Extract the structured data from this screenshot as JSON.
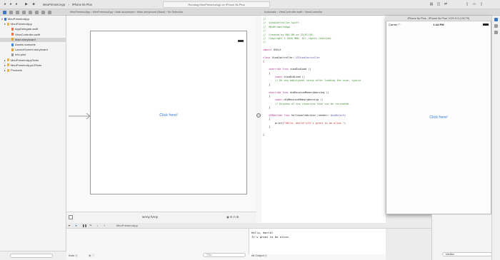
{
  "toolbar": {
    "scheme": "MeuPrimeiroApp",
    "destination": "iPhone 8s Plus",
    "status": "Running MeuPrimeiroApp on iPhone 8s Plus"
  },
  "jump_bar_left": [
    "MeuPrimeiroApp",
    "MeuPrimeiroApp",
    "Main.storyboard",
    "Main.storyboard (Base)",
    "No Selection"
  ],
  "jump_bar_right": [
    "Automatic",
    "ViewController.swift",
    "ViewController"
  ],
  "navigator": {
    "items": [
      {
        "label": "MeuPrimeiroApp",
        "icon": "project-icon",
        "color": "#3a78c2",
        "selected": false
      },
      {
        "label": "MeuPrimeiroApp",
        "icon": "folder-icon",
        "color": "#e5b54a",
        "selected": false
      },
      {
        "label": "AppDelegate.swift",
        "icon": "swift-file-icon",
        "color": "#e8754a",
        "selected": false
      },
      {
        "label": "ViewController.swift",
        "icon": "swift-file-icon",
        "color": "#e8754a",
        "selected": false
      },
      {
        "label": "Main.storyboard",
        "icon": "storyboard-file-icon",
        "color": "#d8a43a",
        "selected": true
      },
      {
        "label": "Assets.xcassets",
        "icon": "assets-icon",
        "color": "#3a8ad8",
        "selected": false
      },
      {
        "label": "LaunchScreen.storyboard",
        "icon": "storyboard-file-icon",
        "color": "#d8a43a",
        "selected": false
      },
      {
        "label": "Info.plist",
        "icon": "plist-icon",
        "color": "#9a9a9a",
        "selected": false
      },
      {
        "label": "MeuPrimeiroAppTests",
        "icon": "folder-icon",
        "color": "#e5b54a",
        "selected": false
      },
      {
        "label": "MeuPrimeiroAppUITests",
        "icon": "folder-icon",
        "color": "#e5b54a",
        "selected": false
      },
      {
        "label": "Products",
        "icon": "folder-icon",
        "color": "#e5b54a",
        "selected": false
      }
    ]
  },
  "storyboard": {
    "button_label": "Click here!",
    "size_class": "wAny hAny"
  },
  "code": {
    "lines": [
      {
        "parts": [
          {
            "t": "//",
            "c": "comment"
          }
        ]
      },
      {
        "parts": [
          {
            "t": "//  ViewController.swift",
            "c": "comment"
          }
        ]
      },
      {
        "parts": [
          {
            "t": "//  MeuPrimeiroApp",
            "c": "comment"
          }
        ]
      },
      {
        "parts": [
          {
            "t": "//",
            "c": "comment"
          }
        ]
      },
      {
        "parts": [
          {
            "t": "//  Created by MAC 08 on 23/07/16.",
            "c": "comment"
          }
        ]
      },
      {
        "parts": [
          {
            "t": "//  Copyright © 2016 BNG. All rights reserved.",
            "c": "comment"
          }
        ]
      },
      {
        "parts": [
          {
            "t": "//",
            "c": "comment"
          }
        ]
      },
      {
        "parts": [
          {
            "t": "",
            "c": "plain"
          }
        ]
      },
      {
        "parts": [
          {
            "t": "import",
            "c": "kw"
          },
          {
            "t": " UIKit",
            "c": "plain"
          }
        ]
      },
      {
        "parts": [
          {
            "t": "",
            "c": "plain"
          }
        ]
      },
      {
        "parts": [
          {
            "t": "class",
            "c": "kw"
          },
          {
            "t": " ViewController: ",
            "c": "plain"
          },
          {
            "t": "UIViewController",
            "c": "type"
          }
        ]
      },
      {
        "parts": [
          {
            "t": "{",
            "c": "plain"
          }
        ]
      },
      {
        "parts": [
          {
            "t": "",
            "c": "plain"
          }
        ]
      },
      {
        "parts": [
          {
            "t": "    ",
            "c": "plain"
          },
          {
            "t": "override func",
            "c": "kw"
          },
          {
            "t": " viewDidLoad ()",
            "c": "plain"
          }
        ]
      },
      {
        "parts": [
          {
            "t": "    {",
            "c": "plain"
          }
        ]
      },
      {
        "parts": [
          {
            "t": "        ",
            "c": "plain"
          },
          {
            "t": "super",
            "c": "kw"
          },
          {
            "t": ".viewDidLoad ()",
            "c": "plain"
          }
        ]
      },
      {
        "parts": [
          {
            "t": "        // Do any additional setup after loading the view, typica",
            "c": "comment"
          }
        ]
      },
      {
        "parts": [
          {
            "t": "    }",
            "c": "plain"
          }
        ]
      },
      {
        "parts": [
          {
            "t": "",
            "c": "plain"
          }
        ]
      },
      {
        "parts": [
          {
            "t": "    ",
            "c": "plain"
          },
          {
            "t": "override func",
            "c": "kw"
          },
          {
            "t": " didReceiveMemoryWarning ()",
            "c": "plain"
          }
        ]
      },
      {
        "parts": [
          {
            "t": "    {",
            "c": "plain"
          }
        ]
      },
      {
        "parts": [
          {
            "t": "        ",
            "c": "plain"
          },
          {
            "t": "super",
            "c": "kw"
          },
          {
            "t": ".didReceiveMemoryWarning ()",
            "c": "plain"
          }
        ]
      },
      {
        "parts": [
          {
            "t": "        // Dispose of any resources that can be recreated.",
            "c": "comment"
          }
        ]
      },
      {
        "parts": [
          {
            "t": "    }",
            "c": "plain"
          }
        ]
      },
      {
        "parts": [
          {
            "t": "",
            "c": "plain"
          }
        ]
      },
      {
        "parts": [
          {
            "t": "    ",
            "c": "plain"
          },
          {
            "t": "@IBAction func",
            "c": "kw"
          },
          {
            "t": " helloworldAction (sender: ",
            "c": "plain"
          },
          {
            "t": "AnyObject",
            "c": "type"
          },
          {
            "t": ")",
            "c": "plain"
          }
        ]
      },
      {
        "parts": [
          {
            "t": "    {",
            "c": "plain"
          }
        ]
      },
      {
        "parts": [
          {
            "t": "        print(",
            "c": "plain"
          },
          {
            "t": "\"Hello, World!\\nIt's great to be alive.\"",
            "c": "str"
          },
          {
            "t": ")",
            "c": "plain"
          }
        ]
      },
      {
        "parts": [
          {
            "t": "    }",
            "c": "plain"
          }
        ]
      },
      {
        "parts": [
          {
            "t": "",
            "c": "plain"
          }
        ]
      },
      {
        "parts": [
          {
            "t": "}",
            "c": "plain"
          }
        ]
      }
    ]
  },
  "simulator": {
    "title": "iPhone 6s Plus - iPhone 6s Plus / iOS 9.3 (13C75)",
    "carrier": "Carrier",
    "time": "1:44 PM",
    "button_label": "Click here!"
  },
  "debug": {
    "breadcrumb": "MeuPrimeiroApp",
    "variables_mode": "Auto ◇",
    "filter_placeholder": "Filter",
    "output_mode": "All Output ◇",
    "console_lines": [
      "Hello, World!",
      "It's great to be alive."
    ],
    "library_filter": "eleollon"
  },
  "colors": {
    "link_blue": "#2b7ad8",
    "selection_gray": "#d6d6d6"
  }
}
